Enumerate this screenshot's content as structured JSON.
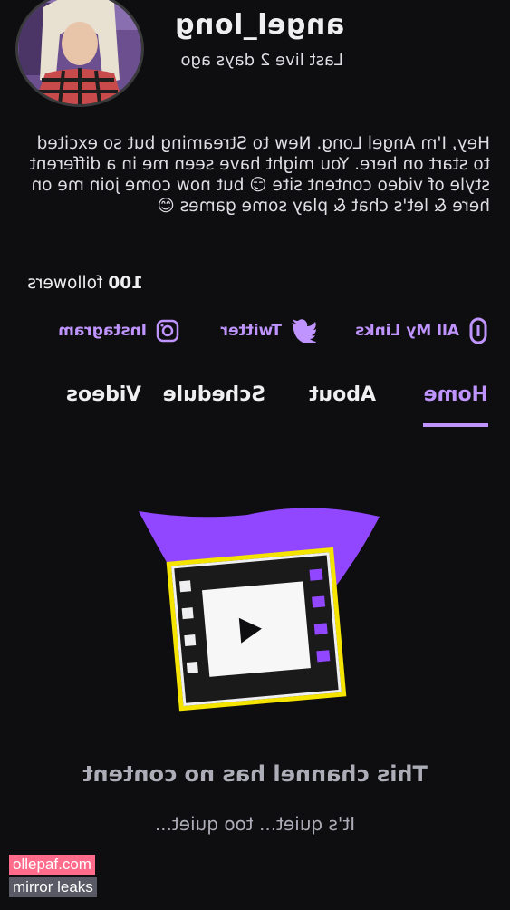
{
  "channel": {
    "username": "angel_long",
    "last_live": "Last live 2 days ago",
    "bio": "Hey, I'm Angel Long. New to Streaming but so excited to start on here. You might have seen me in a different style of video content site 😏  but now come join me on here & let's chat & play some games 😊",
    "followers_count": "100",
    "followers_label": "followers"
  },
  "social_links": [
    {
      "label": "All My Links",
      "icon": "link-icon"
    },
    {
      "label": "Twitter",
      "icon": "twitter-bird-icon"
    },
    {
      "label": "Instagram",
      "icon": "instagram-icon"
    }
  ],
  "tabs": [
    {
      "label": "Home",
      "active": true
    },
    {
      "label": "About",
      "active": false
    },
    {
      "label": "Schedule",
      "active": false
    },
    {
      "label": "Videos",
      "active": false
    }
  ],
  "empty_state": {
    "title": "This channel has no content",
    "subtitle": "It's quiet... too quiet...",
    "illustration": "film-strip-play-icon"
  },
  "watermark": {
    "line1": "ollepaf.com",
    "line2": "mirror leaks"
  },
  "colors": {
    "background": "#0e0e10",
    "accent": "#bf94ff",
    "illustration_purple": "#9147ff",
    "illustration_yellow": "#f5e400"
  }
}
